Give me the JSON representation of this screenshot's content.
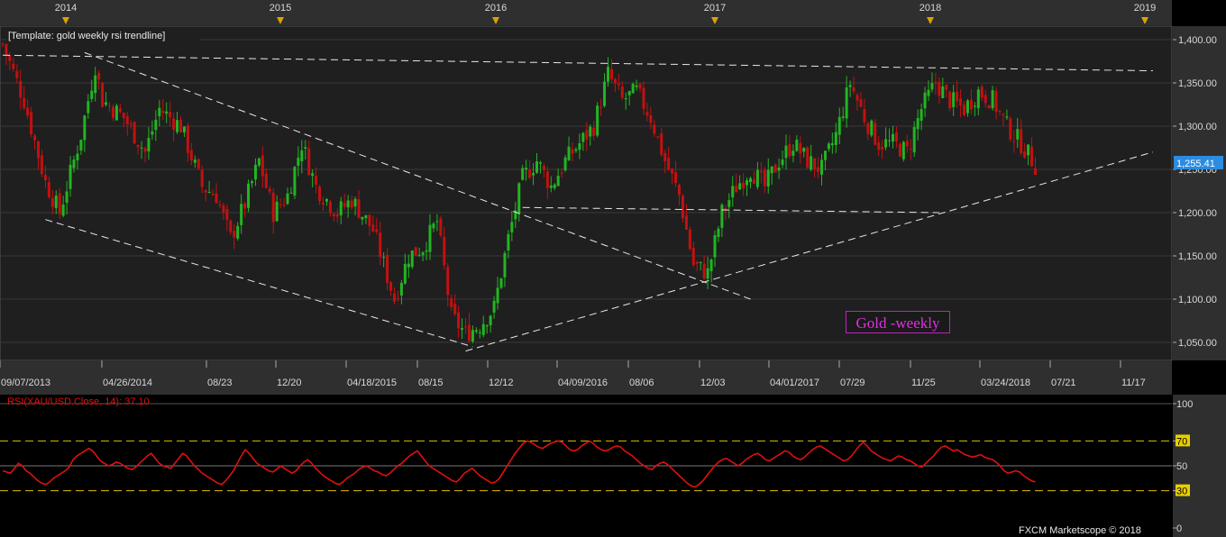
{
  "chart_data": [
    {
      "type": "candlestick",
      "title": "[Template: gold weekly rsi trendline]",
      "instrument_tag": "Gold -weekly",
      "year_labels": [
        "2014",
        "2015",
        "2016",
        "2017",
        "2018",
        "2019"
      ],
      "x_tick_labels": [
        "09/07/2013",
        "04/26/2014",
        "08/23",
        "12/20",
        "04/18/2015",
        "08/15",
        "12/12",
        "04/09/2016",
        "08/06",
        "12/03",
        "04/01/2017",
        "07/29",
        "11/25",
        "03/24/2018",
        "07/21",
        "11/17"
      ],
      "y_tick_labels": [
        "1,400.00",
        "1,350.00",
        "1,300.00",
        "1,250.00",
        "1,200.00",
        "1,150.00",
        "1,100.00",
        "1,050.00"
      ],
      "ylim": [
        1020,
        1420
      ],
      "last_price": "1,255.41",
      "up_color": "#22b522",
      "down_color": "#c41010",
      "close_path": [
        {
          "week": 0,
          "close": 1395
        },
        {
          "week": 6,
          "close": 1330
        },
        {
          "week": 12,
          "close": 1235
        },
        {
          "week": 16,
          "close": 1200
        },
        {
          "week": 22,
          "close": 1290
        },
        {
          "week": 26,
          "close": 1370
        },
        {
          "week": 28,
          "close": 1330
        },
        {
          "week": 34,
          "close": 1310
        },
        {
          "week": 40,
          "close": 1270
        },
        {
          "week": 44,
          "close": 1320
        },
        {
          "week": 50,
          "close": 1300
        },
        {
          "week": 56,
          "close": 1230
        },
        {
          "week": 60,
          "close": 1220
        },
        {
          "week": 64,
          "close": 1170
        },
        {
          "week": 68,
          "close": 1210
        },
        {
          "week": 72,
          "close": 1260
        },
        {
          "week": 76,
          "close": 1200
        },
        {
          "week": 80,
          "close": 1220
        },
        {
          "week": 84,
          "close": 1280
        },
        {
          "week": 88,
          "close": 1230
        },
        {
          "week": 94,
          "close": 1200
        },
        {
          "week": 98,
          "close": 1215
        },
        {
          "week": 104,
          "close": 1180
        },
        {
          "week": 110,
          "close": 1100
        },
        {
          "week": 114,
          "close": 1150
        },
        {
          "week": 118,
          "close": 1160
        },
        {
          "week": 122,
          "close": 1190
        },
        {
          "week": 126,
          "close": 1080
        },
        {
          "week": 130,
          "close": 1060
        },
        {
          "week": 134,
          "close": 1070
        },
        {
          "week": 138,
          "close": 1090
        },
        {
          "week": 142,
          "close": 1170
        },
        {
          "week": 146,
          "close": 1240
        },
        {
          "week": 150,
          "close": 1260
        },
        {
          "week": 154,
          "close": 1230
        },
        {
          "week": 158,
          "close": 1260
        },
        {
          "week": 162,
          "close": 1280
        },
        {
          "week": 166,
          "close": 1300
        },
        {
          "week": 170,
          "close": 1360
        },
        {
          "week": 174,
          "close": 1330
        },
        {
          "week": 178,
          "close": 1340
        },
        {
          "week": 182,
          "close": 1310
        },
        {
          "week": 186,
          "close": 1260
        },
        {
          "week": 190,
          "close": 1220
        },
        {
          "week": 194,
          "close": 1140
        },
        {
          "week": 198,
          "close": 1130
        },
        {
          "week": 202,
          "close": 1200
        },
        {
          "week": 206,
          "close": 1230
        },
        {
          "week": 210,
          "close": 1250
        },
        {
          "week": 214,
          "close": 1230
        },
        {
          "week": 218,
          "close": 1260
        },
        {
          "week": 222,
          "close": 1280
        },
        {
          "week": 226,
          "close": 1260
        },
        {
          "week": 230,
          "close": 1250
        },
        {
          "week": 234,
          "close": 1290
        },
        {
          "week": 238,
          "close": 1350
        },
        {
          "week": 242,
          "close": 1310
        },
        {
          "week": 246,
          "close": 1280
        },
        {
          "week": 250,
          "close": 1280
        },
        {
          "week": 254,
          "close": 1270
        },
        {
          "week": 258,
          "close": 1320
        },
        {
          "week": 262,
          "close": 1350
        },
        {
          "week": 266,
          "close": 1330
        },
        {
          "week": 270,
          "close": 1320
        },
        {
          "week": 274,
          "close": 1340
        },
        {
          "week": 278,
          "close": 1330
        },
        {
          "week": 282,
          "close": 1300
        },
        {
          "week": 286,
          "close": 1280
        },
        {
          "week": 290,
          "close": 1255
        }
      ],
      "trendlines": [
        {
          "from": {
            "week": 0,
            "price": 1382
          },
          "to": {
            "week": 323,
            "price": 1364
          }
        },
        {
          "from": {
            "week": 23,
            "price": 1385
          },
          "to": {
            "week": 210,
            "price": 1100
          }
        },
        {
          "from": {
            "week": 12,
            "price": 1192
          },
          "to": {
            "week": 132,
            "price": 1045
          }
        },
        {
          "from": {
            "week": 146,
            "price": 1206
          },
          "to": {
            "week": 263,
            "price": 1200
          }
        },
        {
          "from": {
            "week": 130,
            "price": 1040
          },
          "to": {
            "week": 323,
            "price": 1270
          }
        }
      ]
    },
    {
      "type": "line",
      "title": "RSI(XAU/USD.Close, 14): 37.10",
      "y_tick_labels": [
        "100",
        "70",
        "50",
        "30",
        "0"
      ],
      "ylim": [
        0,
        100
      ],
      "levels": [
        70,
        50,
        30
      ],
      "line_color": "#e01010",
      "level_color": "#e0c000",
      "series": [
        {
          "values": [
            46,
            45,
            44,
            48,
            52,
            50,
            46,
            44,
            41,
            38,
            36,
            35,
            37,
            40,
            42,
            44,
            46,
            49,
            55,
            58,
            60,
            62,
            64,
            62,
            58,
            54,
            52,
            50,
            51,
            53,
            52,
            50,
            48,
            47,
            49,
            52,
            55,
            58,
            60,
            56,
            52,
            50,
            49,
            48,
            52,
            56,
            60,
            58,
            54,
            50,
            47,
            44,
            42,
            40,
            38,
            36,
            35,
            38,
            42,
            46,
            52,
            58,
            63,
            60,
            56,
            52,
            50,
            48,
            46,
            45,
            47,
            50,
            48,
            46,
            44,
            46,
            50,
            53,
            55,
            52,
            48,
            45,
            42,
            40,
            38,
            36,
            35,
            37,
            40,
            42,
            44,
            47,
            49,
            50,
            48,
            46,
            45,
            43,
            42,
            44,
            47,
            50,
            52,
            55,
            58,
            60,
            62,
            58,
            54,
            50,
            48,
            46,
            44,
            42,
            40,
            38,
            37,
            40,
            44,
            46,
            48,
            45,
            42,
            40,
            38,
            36,
            37,
            40,
            45,
            50,
            55,
            60,
            64,
            68,
            70,
            69,
            67,
            65,
            64,
            66,
            68,
            69,
            70,
            69,
            66,
            63,
            62,
            63,
            66,
            68,
            70,
            68,
            65,
            63,
            62,
            63,
            65,
            66,
            65,
            62,
            60,
            58,
            55,
            52,
            50,
            48,
            47,
            50,
            52,
            53,
            51,
            48,
            45,
            42,
            39,
            36,
            34,
            33,
            35,
            38,
            42,
            46,
            50,
            53,
            55,
            56,
            54,
            52,
            50,
            52,
            55,
            57,
            59,
            60,
            58,
            55,
            54,
            56,
            58,
            60,
            62,
            61,
            58,
            56,
            55,
            57,
            60,
            63,
            65,
            66,
            64,
            62,
            60,
            58,
            56,
            54,
            55,
            58,
            62,
            66,
            69,
            66,
            62,
            60,
            58,
            56,
            55,
            54,
            56,
            58,
            57,
            55,
            54,
            52,
            50,
            49,
            52,
            55,
            58,
            62,
            65,
            66,
            64,
            62,
            63,
            61,
            59,
            58,
            57,
            58,
            59,
            57,
            56,
            55,
            53,
            50,
            46,
            44,
            45,
            46,
            45,
            42,
            40,
            38,
            37
          ]
        }
      ]
    }
  ],
  "footer": {
    "copyright": "FXCM Marketscope © 2018"
  }
}
